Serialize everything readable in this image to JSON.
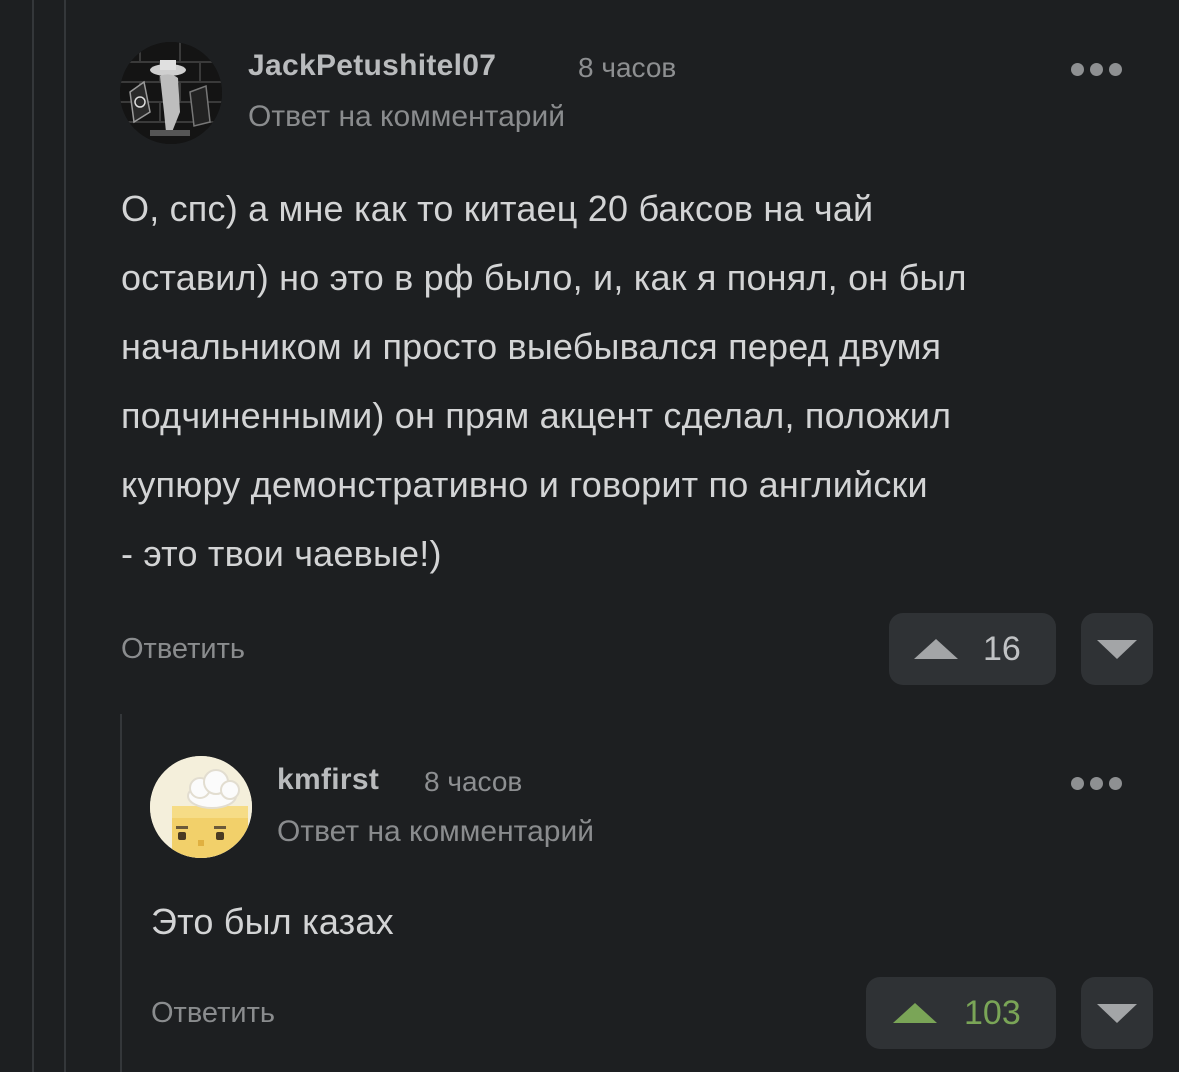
{
  "comments": [
    {
      "username": "JackPetushitel07",
      "time": "8 часов",
      "subtitle": "Ответ на комментарий",
      "lines": [
        "О, спс) а мне как то китаец 20 баксов на чай",
        "оставил) но это в рф было, и, как я понял, он был",
        "начальником и просто выебывался перед двумя",
        "подчиненными) он прям акцент сделал, положил",
        "купюру демонстративно и говорит по английски",
        "- это твои чаевые!)"
      ],
      "reply_label": "Ответить",
      "votes": "16",
      "vote_color": "#9ea0a2"
    },
    {
      "username": "kmfirst",
      "time": "8 часов",
      "subtitle": "Ответ на комментарий",
      "lines": [
        "Это был казах"
      ],
      "reply_label": "Ответить",
      "votes": "103",
      "vote_color": "#7aa557"
    }
  ],
  "icons": {
    "more": "more-dots-icon",
    "upvote": "triangle-up-icon",
    "downvote": "triangle-down-icon"
  }
}
